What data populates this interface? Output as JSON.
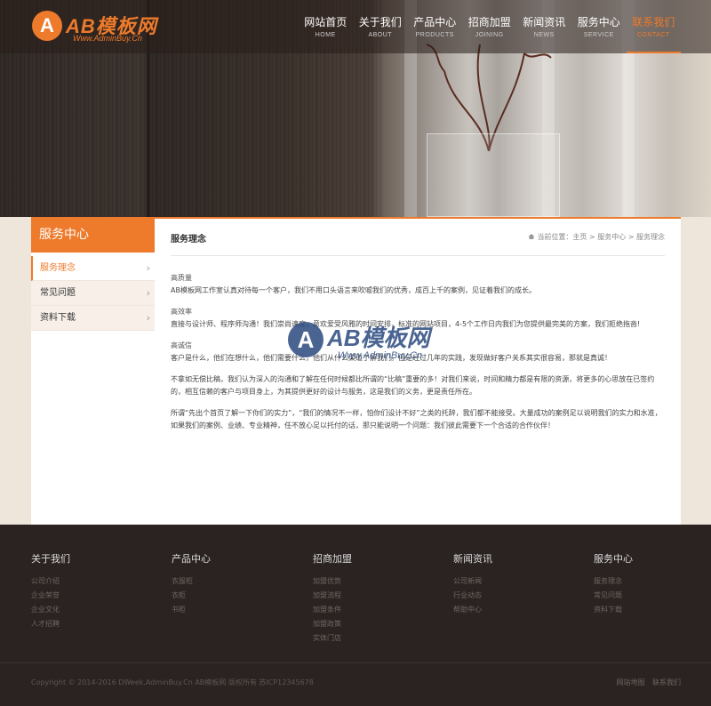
{
  "logo": {
    "mark": "A",
    "text": "AB模板网",
    "sub": "Www.AdminBuy.Cn"
  },
  "nav": [
    {
      "cn": "网站首页",
      "en": "HOME"
    },
    {
      "cn": "关于我们",
      "en": "ABOUT"
    },
    {
      "cn": "产品中心",
      "en": "PRODUCTS"
    },
    {
      "cn": "招商加盟",
      "en": "JOINING"
    },
    {
      "cn": "新闻资讯",
      "en": "NEWS"
    },
    {
      "cn": "服务中心",
      "en": "SERVICE"
    },
    {
      "cn": "联系我们",
      "en": "CONTACT"
    }
  ],
  "sidebar": {
    "title": "服务中心",
    "items": [
      {
        "label": "服务理念",
        "icon": "chevron-right-icon"
      },
      {
        "label": "常见问题",
        "icon": "chevron-right-icon"
      },
      {
        "label": "资料下载",
        "icon": "chevron-right-icon"
      }
    ]
  },
  "main": {
    "title": "服务理念",
    "breadcrumb": "当前位置：主页 > 服务中心 > 服务理念",
    "paragraphs": [
      "高质量",
      "AB模板网工作室认真对待每一个客户，我们不用口头语言来吹嘘我们的优秀，成百上千的案例，见证着我们的成长。",
      "高效率",
      "直接与设计师、程序师沟通！我们崇尚速度，意欢爱受风雅的时间安排，标准的网站项目，4-5个工作日内我们为您提供最完美的方案，我们拒绝拖沓!",
      "高诚信",
      "客户是什么，他们在想什么，他们需要什么，他们从什么渠道了解我们。但是经过几年的实践，发现做好客户关系其实很容易，那就是真诚！",
      "不拿如无偿比稿，我们认为深入的沟通和了解在任何时候都比所谓的“比稿”重要的多！对我们来说，时间和精力都是有限的资源，将更多的心思放在已签约的，相互信赖的客户与项目身上，为其提供更好的设计与服务，这是我们的义务，更是责任所在。",
      "所谓“先出个首页了解一下你们的实力”，“我们的情况不一样，怕你们设计不好”之类的托辞，我们都不能接受。大量成功的案例足以说明我们的实力和水准，如果我们的案例、业绩、专业精神，任不放心足以托付的话，那只能说明一个问题：我们彼此需要下一个合适的合作伙伴！"
    ]
  },
  "watermark": {
    "mark": "A",
    "text": "AB模板网",
    "sub": "Www.AdminBuy.Cn"
  },
  "footer": {
    "columns": [
      {
        "title": "关于我们",
        "links": [
          "公司介绍",
          "企业荣誉",
          "企业文化",
          "人才招聘"
        ]
      },
      {
        "title": "产品中心",
        "links": [
          "衣服柜",
          "衣柜",
          "书柜"
        ]
      },
      {
        "title": "招商加盟",
        "links": [
          "加盟优势",
          "加盟流程",
          "加盟条件",
          "加盟政策",
          "实体门店"
        ]
      },
      {
        "title": "新闻资讯",
        "links": [
          "公司新闻",
          "行业动态",
          "帮助中心"
        ]
      },
      {
        "title": "服务中心",
        "links": [
          "服务理念",
          "常见问题",
          "资料下载"
        ]
      }
    ],
    "copyright": "Copyright © 2014-2016 DWeek.AdminBuy.Cn AB模板网 版权所有  苏ICP12345678",
    "bottom_links": [
      "网站地图",
      "联系我们"
    ]
  },
  "colors": {
    "accent": "#ee7a2b",
    "footer_bg": "#2a2321",
    "page_bg": "#efe6db"
  }
}
